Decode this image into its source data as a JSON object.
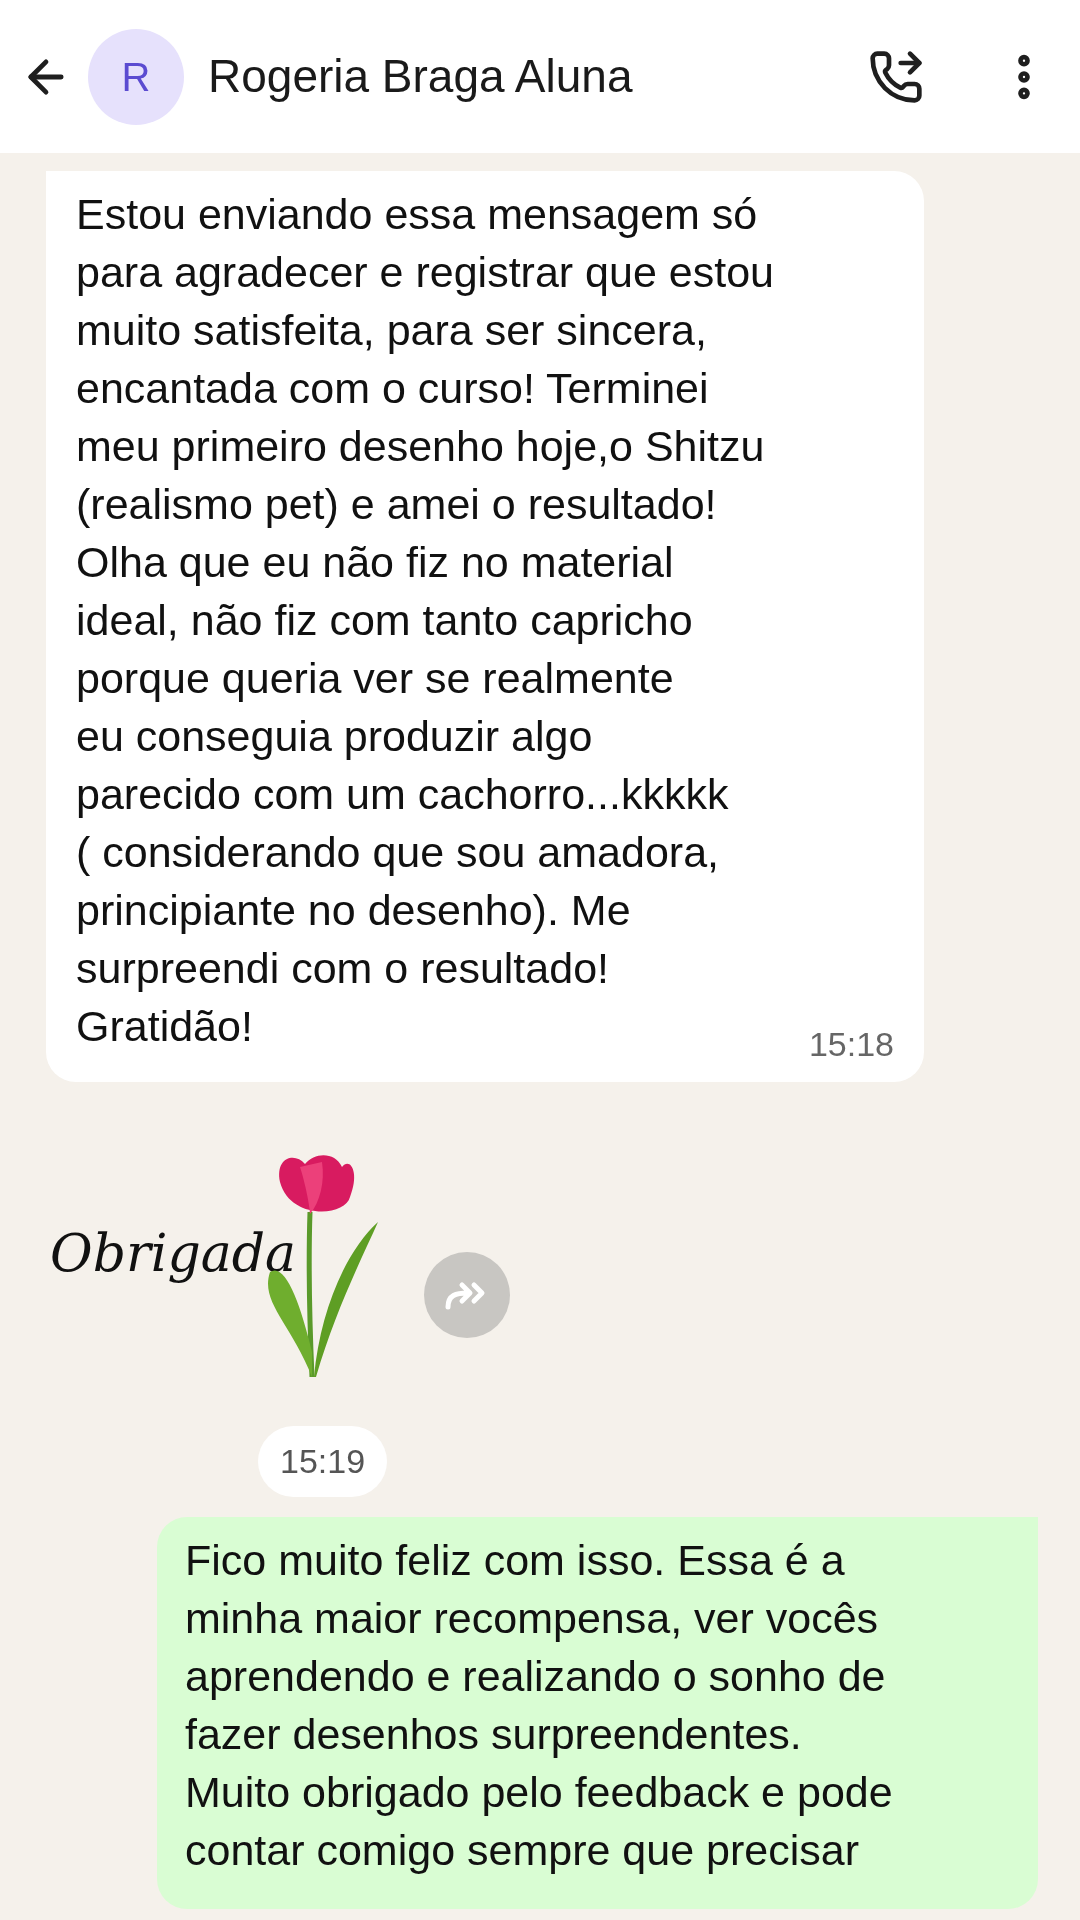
{
  "header": {
    "avatar_letter": "R",
    "contact_name": "Rogeria Braga Aluna"
  },
  "messages": [
    {
      "kind": "incoming",
      "text": "Estou enviando essa mensagem só\npara agradecer e registrar que estou\nmuito satisfeita, para ser sincera,\nencantada com o curso!  Terminei\nmeu primeiro desenho hoje,o Shitzu\n(realismo pet) e amei o resultado!\nOlha que eu não fiz no material\nideal, não fiz com tanto capricho\nporque queria ver se  realmente\neu conseguia produzir algo\nparecido com um cachorro...kkkkk\n( considerando que sou amadora,\nprincipiante no desenho). Me\nsurpreendi com o resultado!\nGratidão!",
      "time": "15:18"
    },
    {
      "kind": "sticker",
      "caption": "Obrigada",
      "time": "15:19"
    },
    {
      "kind": "outgoing",
      "text": "Fico muito feliz com isso. Essa é a\nminha maior recompensa, ver vocês\naprendendo e realizando o sonho de\nfazer desenhos surpreendentes.\nMuito obrigado pelo feedback e pode\ncontar comigo sempre que precisar"
    }
  ]
}
